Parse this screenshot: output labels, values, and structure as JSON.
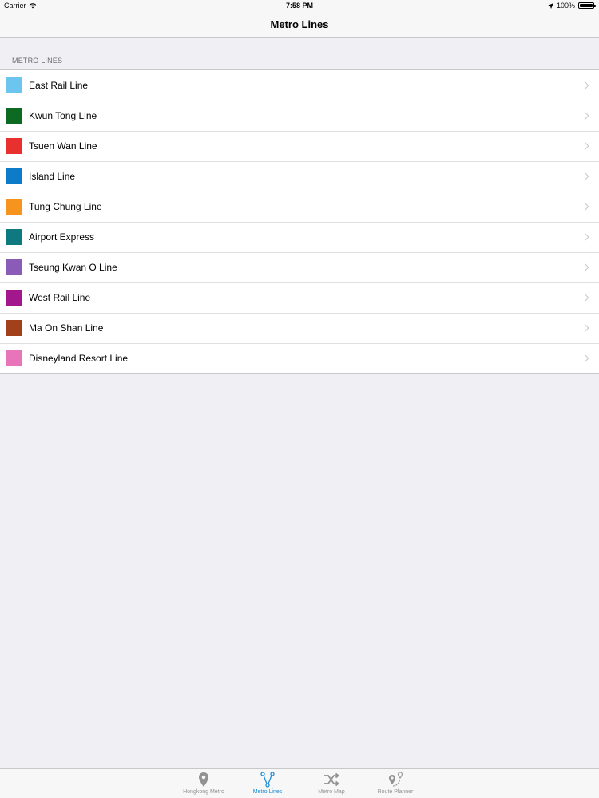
{
  "status_bar": {
    "carrier": "Carrier",
    "time": "7:58 PM",
    "battery_text": "100%",
    "battery_level": 1.0
  },
  "nav": {
    "title": "Metro Lines"
  },
  "section": {
    "header": "METRO LINES"
  },
  "lines": [
    {
      "name": "East Rail Line",
      "color": "#6cc5ef"
    },
    {
      "name": "Kwun Tong Line",
      "color": "#0d6a22"
    },
    {
      "name": "Tsuen Wan Line",
      "color": "#e8302e"
    },
    {
      "name": "Island Line",
      "color": "#0d7bc7"
    },
    {
      "name": "Tung Chung Line",
      "color": "#f7941d"
    },
    {
      "name": "Airport Express",
      "color": "#0e7a80"
    },
    {
      "name": "Tseung Kwan O Line",
      "color": "#8b5bb8"
    },
    {
      "name": "West Rail Line",
      "color": "#a3178c"
    },
    {
      "name": "Ma On Shan Line",
      "color": "#a1401a"
    },
    {
      "name": "Disneyland Resort Line",
      "color": "#e874b9"
    }
  ],
  "tabs": [
    {
      "label": "Hongkong Metro",
      "icon": "location-pin-icon",
      "active": false
    },
    {
      "label": "Metro Lines",
      "icon": "branch-lines-icon",
      "active": true
    },
    {
      "label": "Metro Map",
      "icon": "shuffle-icon",
      "active": false
    },
    {
      "label": "Route Planner",
      "icon": "route-icon",
      "active": false
    }
  ],
  "colors": {
    "accent": "#1a8cd8",
    "inactive_tab": "#929292",
    "background": "#efeff4"
  }
}
